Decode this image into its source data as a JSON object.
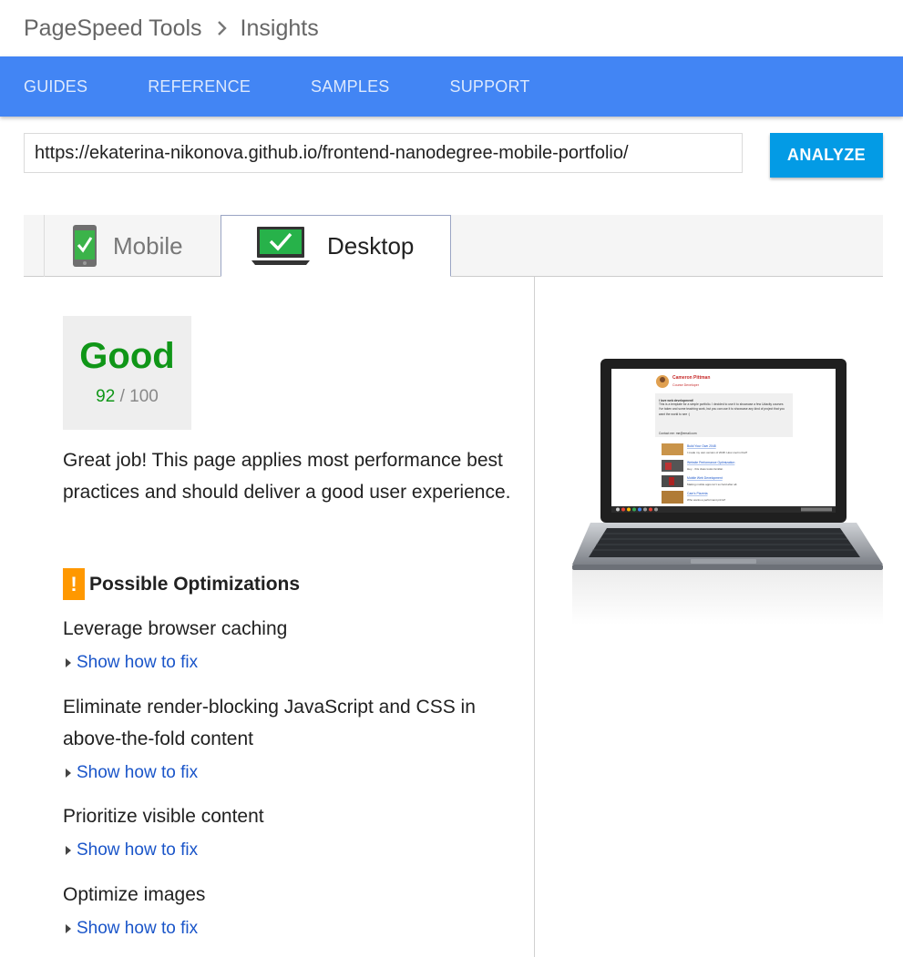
{
  "breadcrumb": {
    "root": "PageSpeed Tools",
    "current": "Insights"
  },
  "nav": {
    "items": [
      "GUIDES",
      "REFERENCE",
      "SAMPLES",
      "SUPPORT"
    ]
  },
  "search": {
    "url_value": "https://ekaterina-nikonova.github.io/frontend-nanodegree-mobile-portfolio/",
    "analyze_label": "ANALYZE"
  },
  "tabs": {
    "mobile": "Mobile",
    "desktop": "Desktop",
    "active": "desktop"
  },
  "score": {
    "label": "Good",
    "value": "92",
    "max": "/ 100"
  },
  "summary": "Great job! This page applies most performance best practices and should deliver a good user experience.",
  "optimizations": {
    "title": "Possible Optimizations",
    "icon": "!",
    "items": [
      {
        "title": "Leverage browser caching",
        "link": "Show how to fix"
      },
      {
        "title": "Eliminate render-blocking JavaScript and CSS in above-the-fold content",
        "link": "Show how to fix"
      },
      {
        "title": "Prioritize visible content",
        "link": "Show how to fix"
      },
      {
        "title": "Optimize images",
        "link": "Show how to fix"
      }
    ]
  },
  "preview": {
    "name": "Cameron Pittman",
    "role": "Course Developer",
    "intro_bold": "I love web development!",
    "intro_rest": "This is a template for a simple portfolio. I decided to use it to showcase a few Udacity courses I've taken and some teaching work, but you can use it to showcase any kind of project that you want the world to see :)",
    "contact": "Contact me: me@email.com",
    "projects": [
      {
        "title": "Build Your Own 2048",
        "desc": "I made my own version of 2048. How cool is that?"
      },
      {
        "title": "Website Performance Optimization",
        "desc": "Hey... this class looks familiar."
      },
      {
        "title": "Mobile Web Development",
        "desc": "Making mobile apps isn't so hard after all."
      },
      {
        "title": "Cam's Pizzeria",
        "desc": "Who wants a performant pizza?"
      }
    ]
  },
  "colors": {
    "nav": "#4285f4",
    "analyze": "#039be5",
    "good": "#109618",
    "warning": "#ff9800",
    "link": "#1a55c9"
  }
}
